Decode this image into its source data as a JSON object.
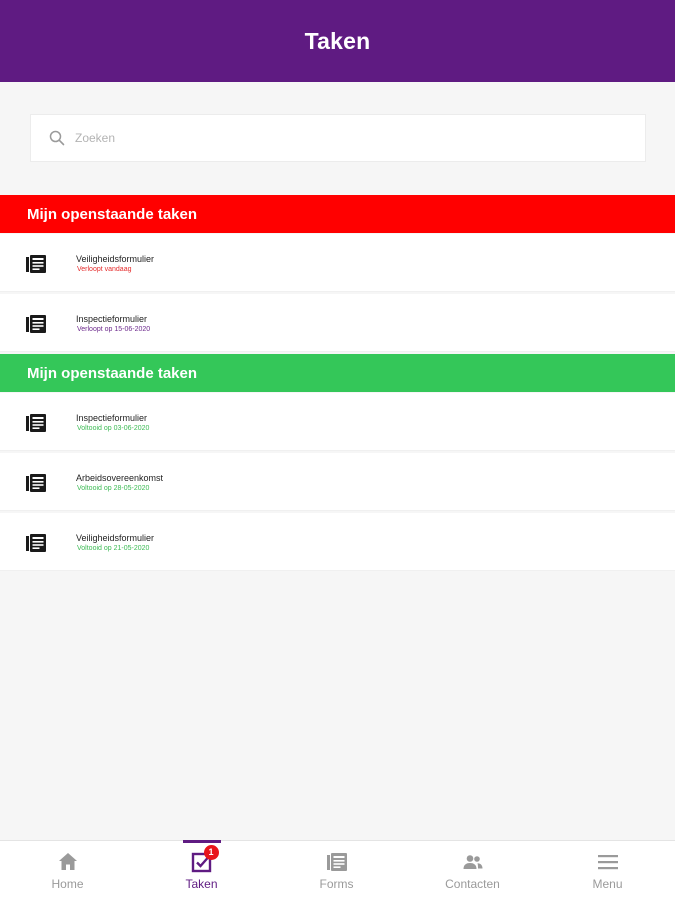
{
  "header": {
    "title": "Taken"
  },
  "search": {
    "placeholder": "Zoeken",
    "value": ""
  },
  "sections": [
    {
      "title": "Mijn openstaande taken",
      "color": "#ff0000",
      "items": [
        {
          "title": "Veiligheidsformulier",
          "status": "Verloopt vandaag",
          "status_color": "#e52b2b",
          "icon": "form-icon"
        },
        {
          "title": "Inspectieformulier",
          "status": "Verloopt op 15-06-2020",
          "status_color": "#6c2a8c",
          "icon": "form-icon"
        }
      ]
    },
    {
      "title": "Mijn openstaande taken",
      "color": "#34c759",
      "items": [
        {
          "title": "Inspectieformulier",
          "status": "Voltooid op 03-06-2020",
          "status_color": "#3dbb55",
          "icon": "form-icon"
        },
        {
          "title": "Arbeidsovereenkomst",
          "status": "Voltooid op 28-05-2020",
          "status_color": "#3dbb55",
          "icon": "form-icon"
        },
        {
          "title": "Veiligheidsformulier",
          "status": "Voltooid op 21-05-2020",
          "status_color": "#3dbb55",
          "icon": "form-icon"
        }
      ]
    }
  ],
  "tabbar": {
    "active_color": "#5f1b82",
    "inactive_color": "#9a9a9a",
    "tabs": [
      {
        "label": "Home",
        "icon": "home-icon",
        "active": false
      },
      {
        "label": "Taken",
        "icon": "tasks-icon",
        "active": true,
        "badge": "1"
      },
      {
        "label": "Forms",
        "icon": "forms-icon",
        "active": false
      },
      {
        "label": "Contacten",
        "icon": "contacts-icon",
        "active": false
      },
      {
        "label": "Menu",
        "icon": "menu-icon",
        "active": false
      }
    ]
  }
}
